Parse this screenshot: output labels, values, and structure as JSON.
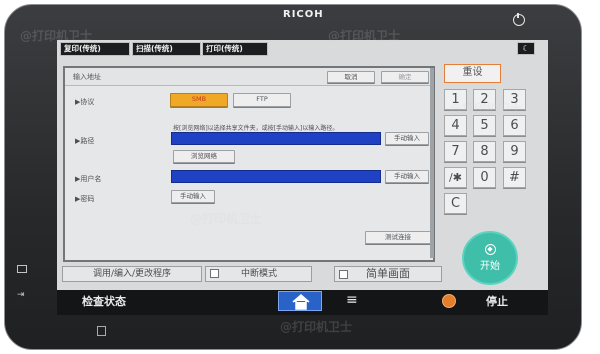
{
  "device": {
    "brand": "RICOH"
  },
  "top_tabs": [
    "复印(传统)",
    "扫描(传统)",
    "打印(传统)"
  ],
  "panel": {
    "title": "输入地址",
    "cancel": "取消",
    "ok": "确定",
    "protocol_label": "▶协议",
    "protocol_options": [
      "SMB",
      "FTP"
    ],
    "path_hint": "按[浏览网络]以选择共享文件夹，或按[手动输入]以输入路径。",
    "path_label": "▶路径",
    "manual_input": "手动输入",
    "browse_network": "浏览网络",
    "username_label": "▶用户名",
    "password_label": "▶密码",
    "connection_test": "测试连接"
  },
  "keypad": {
    "reset": "重设",
    "keys": [
      "1",
      "2",
      "3",
      "4",
      "5",
      "6",
      "7",
      "8",
      "9",
      "/✱",
      "0",
      "#",
      "C"
    ]
  },
  "start_label": "开始",
  "bottom": {
    "program": "调用/编入/更改程序",
    "interrupt": "中断模式",
    "simple": "简单画面"
  },
  "status_bar": {
    "check_status": "检查状态",
    "menu": "≡",
    "stop": "停止"
  },
  "watermark": "@打印机卫士",
  "colors": {
    "accent_blue": "#1f41c3",
    "start": "#3fbfaa",
    "stop": "#e37f2b",
    "protocol_selected": "#f0a826"
  }
}
